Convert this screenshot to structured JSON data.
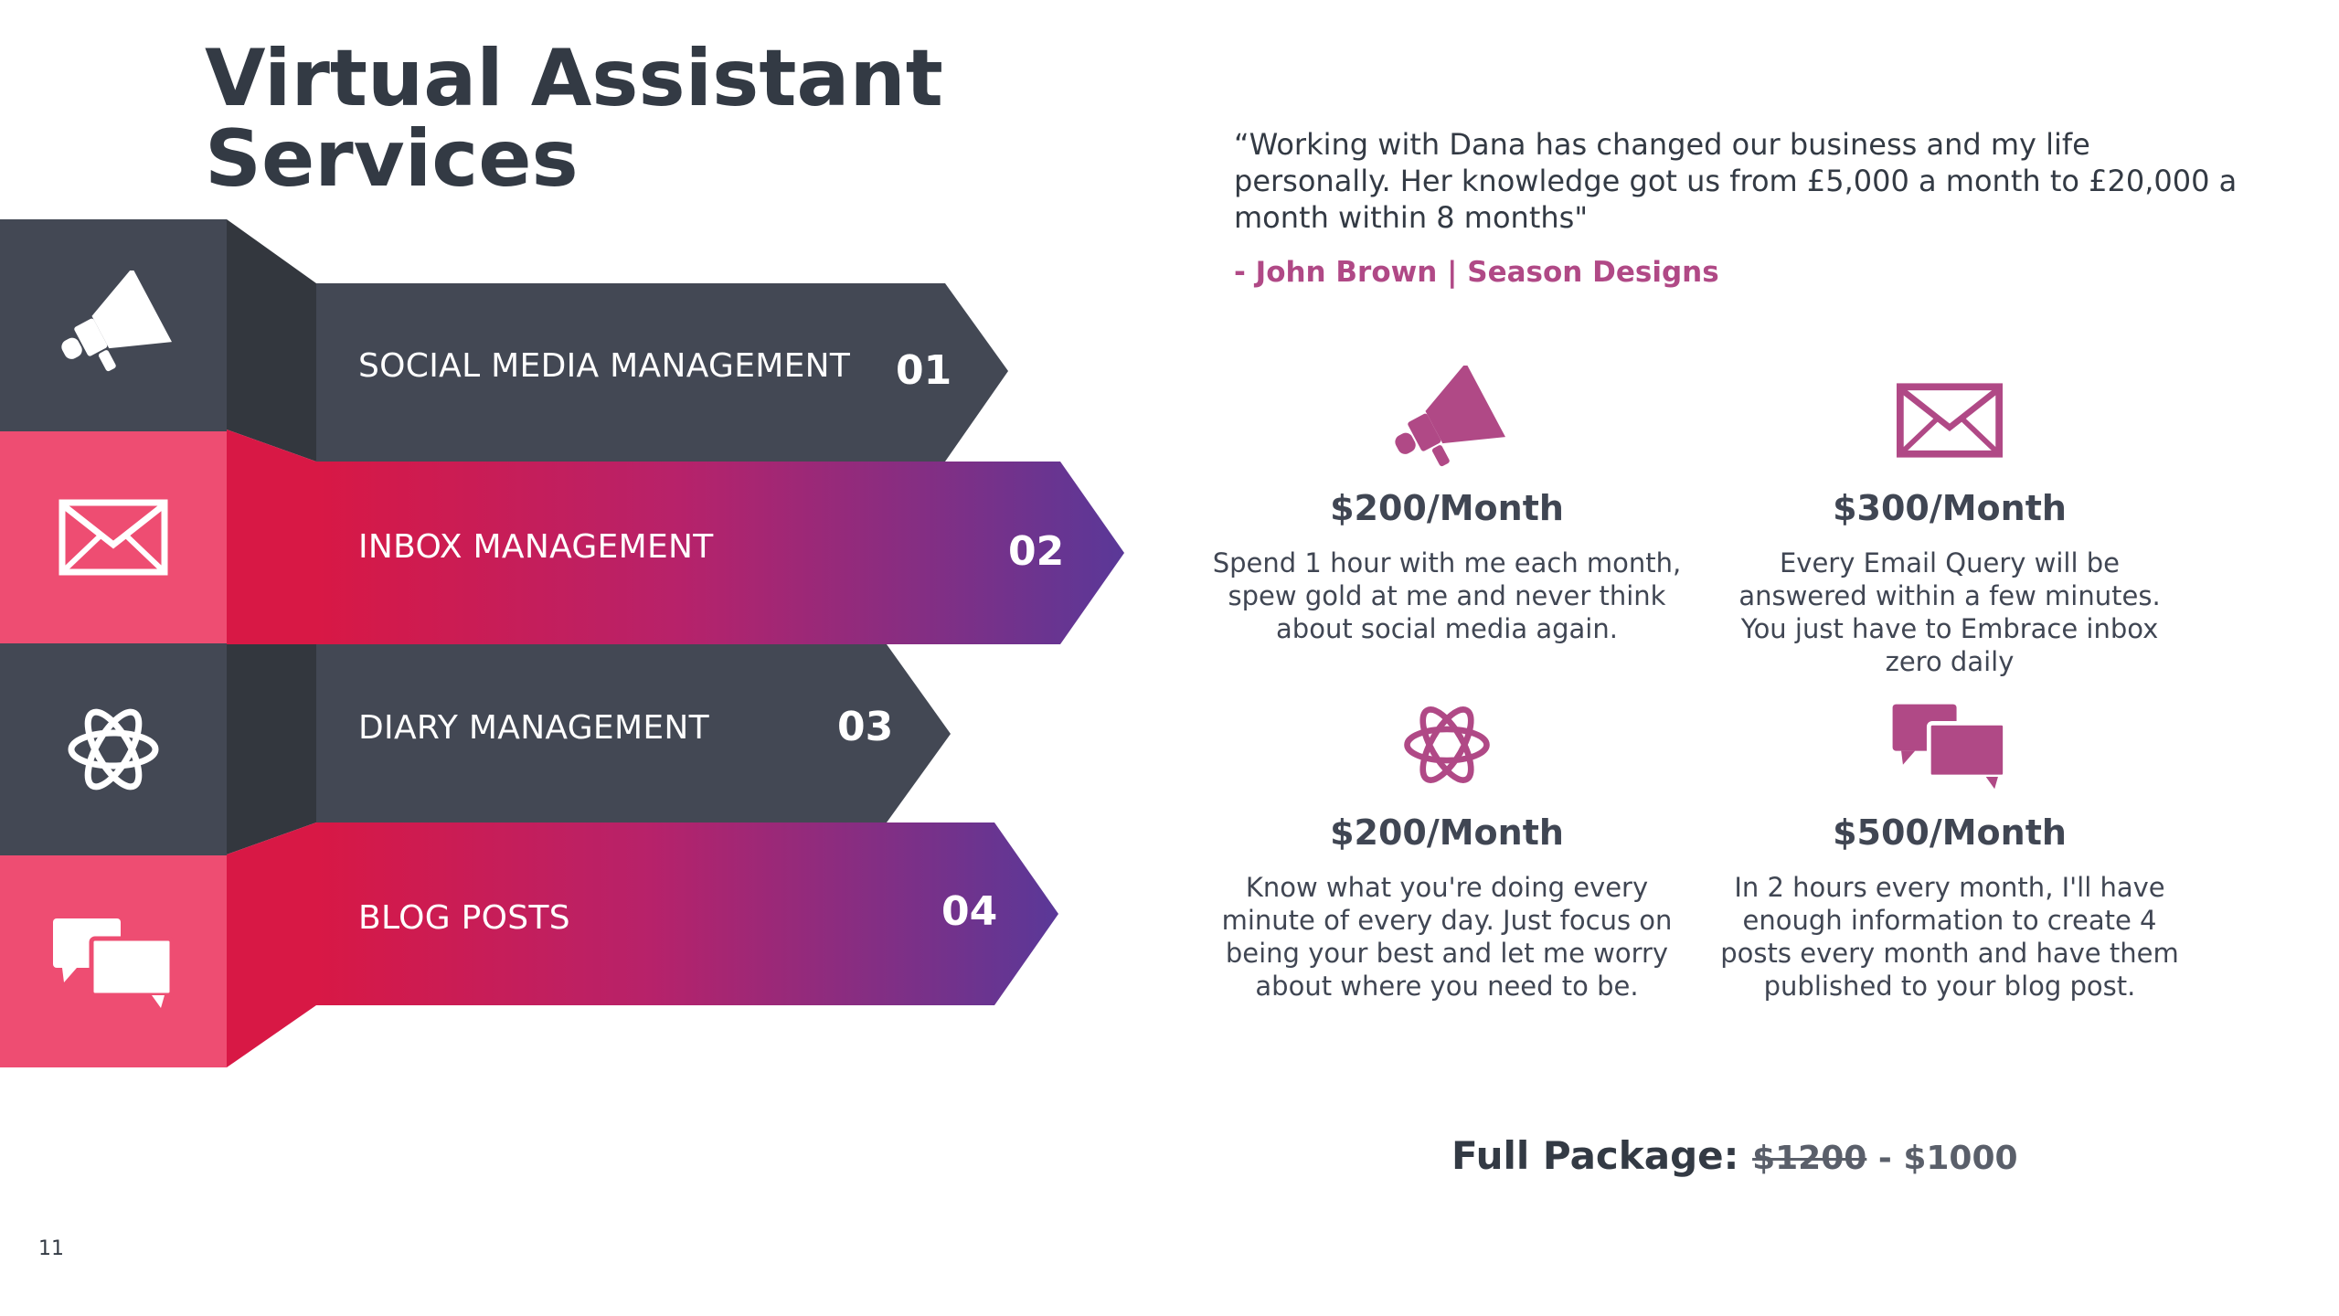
{
  "title_line1": "Virtual Assistant",
  "title_line2": "Services",
  "services": [
    {
      "label": "SOCIAL MEDIA MANAGEMENT",
      "number": "01"
    },
    {
      "label": "INBOX MANAGEMENT",
      "number": "02"
    },
    {
      "label": "DIARY MANAGEMENT",
      "number": "03"
    },
    {
      "label": "BLOG POSTS",
      "number": "04"
    }
  ],
  "testimonial": {
    "quote": "“Working with Dana has changed our business and my life personally. Her knowledge got us from £5,000 a month to £20,000 a month within 8 months\"",
    "author": "- John Brown | Season Designs"
  },
  "pricing": [
    {
      "icon": "megaphone-icon",
      "price": "$200/Month",
      "description": "Spend 1 hour with me each month, spew gold at me and never think about social media again."
    },
    {
      "icon": "envelope-icon",
      "price": "$300/Month",
      "description": "Every Email Query will be answered within a few minutes. You just have to Embrace inbox zero daily"
    },
    {
      "icon": "atom-icon",
      "price": "$200/Month",
      "description": "Know what you're doing every minute of every day. Just focus on being your best and let me worry about where you need to be."
    },
    {
      "icon": "chat-bubbles-icon",
      "price": "$500/Month",
      "description": "In 2 hours every month, I'll have enough information to create 4 posts every month and have them published to your blog post."
    }
  ],
  "package": {
    "label": "Full Package:",
    "old_price": "$1200",
    "separator": " - ",
    "new_price": "$1000"
  },
  "page_number": "11",
  "colors": {
    "dark": "#434854",
    "darker": "#33373e",
    "pink": "#ee4d72",
    "red": "#d81845",
    "purple": "#5a3898",
    "accent": "#b04986"
  }
}
